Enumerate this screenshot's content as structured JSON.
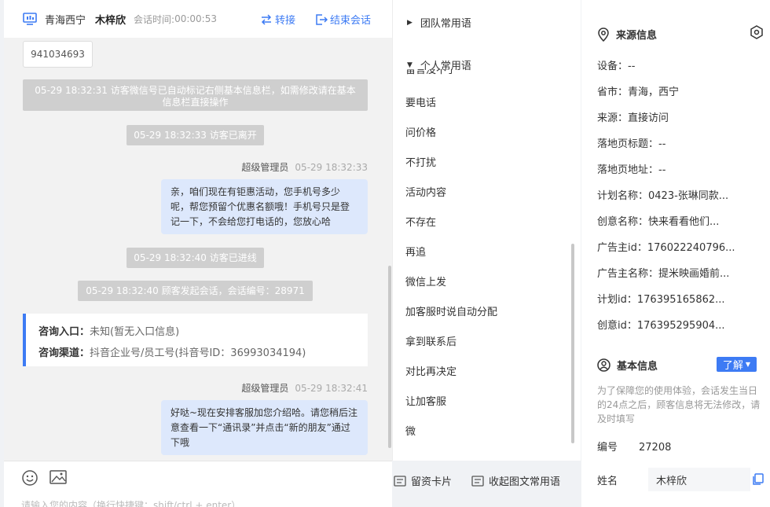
{
  "header": {
    "location": "青海西宁",
    "visitor_name": "木梓欣",
    "session_time_label": "会话时间:",
    "session_time": "00:00:53",
    "transfer_label": "转接",
    "end_label": "结束会话"
  },
  "messages": {
    "phone_card": "941034693",
    "sys1": "05-29 18:32:31 访客微信号已自动标记右侧基本信息栏，如需修改请在基本信息栏直接操作",
    "sys2": "05-29 18:32:33 访客已离开",
    "agent1_name": "超级管理员",
    "agent1_time": "05-29 18:32:33",
    "agent1_text": "亲，咱们现在有钜惠活动，您手机号多少呢，帮您预留个优惠名额哦！手机号只是登记一下，不会给您打电话的，您放心哈",
    "sys3": "05-29 18:32:40 访客已进线",
    "sys4": "05-29 18:32:40 顾客发起会话，会话编号：28971",
    "consult_entry_label": "咨询入口：",
    "consult_entry_value": "未知(暂无入口信息)",
    "consult_channel_label": "咨询渠道：",
    "consult_channel_value": "抖音企业号/员工号(抖音号ID：36993034194)",
    "agent2_name": "超级管理员",
    "agent2_time": "05-29 18:32:41",
    "agent2_text": "好哒~现在安排客服加您介绍哈。请您稍后注意查看一下“通讯录”并点击“新的朋友”通过下哦"
  },
  "toolbar": {
    "card_label": "留资卡片",
    "collapse_label": "收起图文常用语",
    "input_placeholder": "请输入您的内容（换行快捷键：shift/ctrl + enter）"
  },
  "phrases": {
    "team_group": "团队常用语",
    "personal_group": "个人常用语",
    "clipped_item": "留言没不了",
    "items": [
      "要电话",
      "问价格",
      "不打扰",
      "活动内容",
      "不存在",
      "再追",
      "微信上发",
      "加客服时说自动分配",
      "拿到联系后",
      "对比再决定",
      "让加客服",
      "微"
    ]
  },
  "source": {
    "title": "来源信息",
    "rows": [
      {
        "k": "设备：",
        "v": "--"
      },
      {
        "k": "省市：",
        "v": "青海，西宁"
      },
      {
        "k": "来源：",
        "v": "直接访问"
      },
      {
        "k": "落地页标题：",
        "v": "--"
      },
      {
        "k": "落地页地址：",
        "v": "--"
      },
      {
        "k": "计划名称：",
        "v": "0423-张琳同款..."
      },
      {
        "k": "创意名称：",
        "v": "快来看看他们..."
      },
      {
        "k": "广告主id：",
        "v": "176022240796..."
      },
      {
        "k": "广告主名称：",
        "v": "提米映画婚前..."
      },
      {
        "k": "计划id：",
        "v": "176395165862..."
      },
      {
        "k": "创意id：",
        "v": "176395295904..."
      }
    ]
  },
  "basic": {
    "title": "基本信息",
    "learn_label": "了解",
    "notice": "为了保障您的使用体验，会话发生当日的24点之后，顾客信息将无法修改，请及时填写",
    "id_label": "编号",
    "id_value": "27208",
    "name_label": "姓名",
    "name_value": "木梓欣"
  },
  "colors": {
    "accent": "#3d7bf4",
    "bubble": "#dde8fc",
    "system_msg": "#cfcfcf"
  }
}
